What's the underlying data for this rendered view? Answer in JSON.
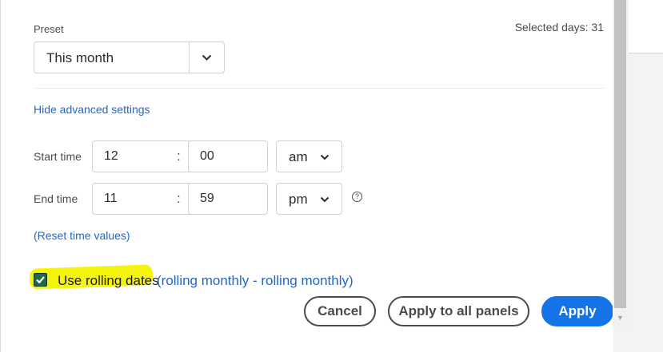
{
  "preset": {
    "label": "Preset",
    "value": "This month",
    "selected_days": "Selected days: 31"
  },
  "advanced": {
    "hide_link": "Hide advanced settings",
    "start_time": {
      "label": "Start time",
      "hour": "12",
      "minute": "00",
      "period": "am"
    },
    "end_time": {
      "label": "End time",
      "hour": "11",
      "minute": "59",
      "period": "pm"
    },
    "separator": ":",
    "help_icon": "?",
    "reset_link": "(Reset time values)"
  },
  "rolling": {
    "checked": true,
    "label": "Use rolling dates",
    "description": "(rolling monthly - rolling monthly)"
  },
  "buttons": {
    "cancel": "Cancel",
    "apply_all": "Apply to all panels",
    "apply": "Apply"
  },
  "colors": {
    "accent": "#1473e6",
    "link": "#2467c8",
    "highlight": "#f5f50b",
    "checkbox": "#1f6b47"
  }
}
